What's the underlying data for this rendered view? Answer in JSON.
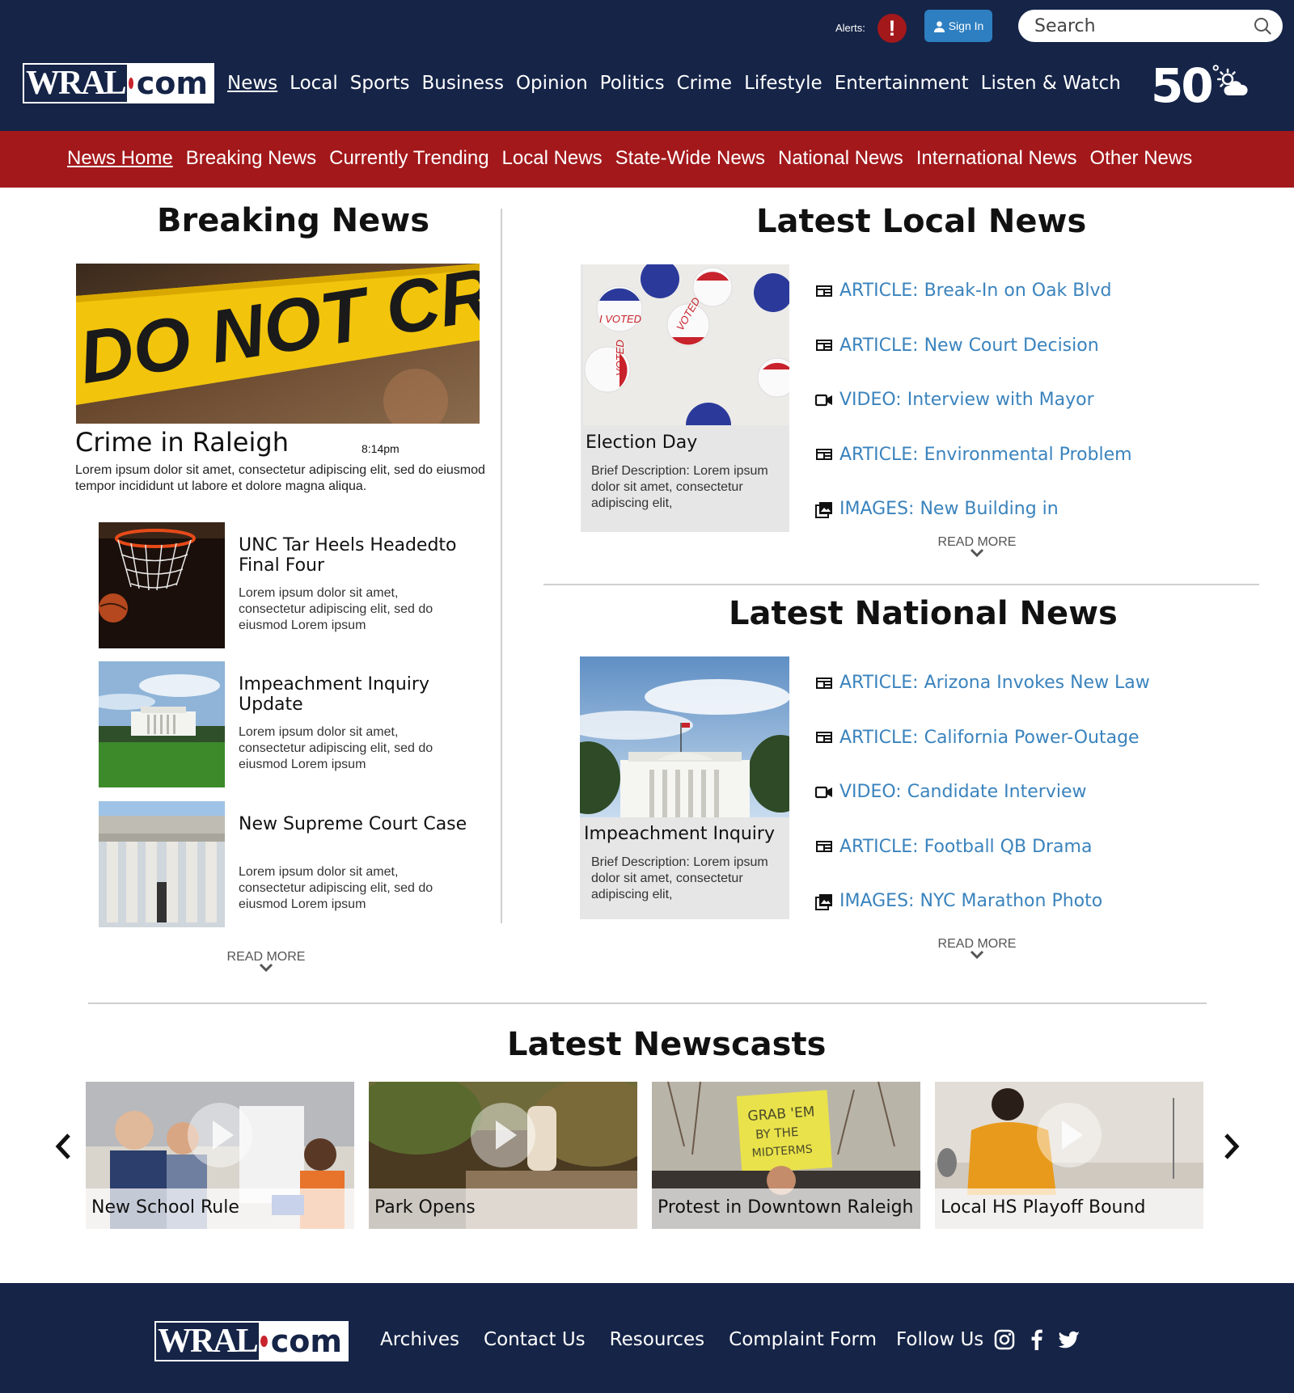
{
  "header": {
    "alerts_label": "Alerts:",
    "alert_glyph": "!",
    "signin_label": "Sign In",
    "search_placeholder": "Search",
    "logo": {
      "wral": "WRAL",
      "com": "com"
    },
    "main_nav": [
      "News",
      "Local",
      "Sports",
      "Business",
      "Opinion",
      "Politics",
      "Crime",
      "Lifestyle",
      "Entertainment",
      "Listen & Watch"
    ],
    "active_nav": "News",
    "weather": {
      "temperature": "50",
      "degree": "°",
      "icon": "partly-cloudy-icon"
    }
  },
  "subnav": {
    "items": [
      "News Home",
      "Breaking News",
      "Currently Trending",
      "Local News",
      "State-Wide News",
      "National News",
      "International News",
      "Other News"
    ],
    "active": "News Home"
  },
  "breaking": {
    "title": "Breaking News",
    "featured": {
      "headline": "Crime in Raleigh",
      "time": "8:14pm",
      "summary": "Lorem ipsum dolor sit amet, consectetur adipiscing elit, sed do eiusmod tempor incididunt ut labore et dolore magna aliqua.",
      "tape_text": "DO NOT CROSS POLICE"
    },
    "stories": [
      {
        "title": "UNC Tar Heels Headedto Final Four",
        "summary": "Lorem ipsum dolor sit amet, consectetur adipiscing elit, sed do eiusmod Lorem ipsum"
      },
      {
        "title": "Impeachment Inquiry Update",
        "summary": "Lorem ipsum dolor sit amet, consectetur adipiscing elit, sed do eiusmod Lorem ipsum"
      },
      {
        "title": "New Supreme Court Case",
        "summary": "Lorem ipsum dolor sit amet, consectetur adipiscing elit, sed do eiusmod Lorem ipsum"
      }
    ],
    "read_more": "READ MORE"
  },
  "local": {
    "title": "Latest Local News",
    "feature": {
      "title": "Election Day",
      "description": "Brief Description: Lorem ipsum dolor sit amet, consectetur adipiscing elit,"
    },
    "links": [
      {
        "type": "article",
        "icon": "article-icon",
        "text": "ARTICLE: Break-In on Oak Blvd"
      },
      {
        "type": "article",
        "icon": "article-icon",
        "text": "ARTICLE: New Court Decision"
      },
      {
        "type": "video",
        "icon": "video-icon",
        "text": "VIDEO: Interview with Mayor"
      },
      {
        "type": "article",
        "icon": "article-icon",
        "text": "ARTICLE: Environmental Problem"
      },
      {
        "type": "images",
        "icon": "images-icon",
        "text": "IMAGES: New Building in"
      }
    ],
    "read_more": "READ MORE"
  },
  "national": {
    "title": "Latest National News",
    "feature": {
      "title": "Impeachment Inquiry",
      "description": "Brief Description: Lorem ipsum dolor sit amet, consectetur adipiscing elit,"
    },
    "links": [
      {
        "type": "article",
        "icon": "article-icon",
        "text": "ARTICLE: Arizona Invokes New Law"
      },
      {
        "type": "article",
        "icon": "article-icon",
        "text": "ARTICLE: California Power-Outage"
      },
      {
        "type": "video",
        "icon": "video-icon",
        "text": "VIDEO: Candidate Interview"
      },
      {
        "type": "article",
        "icon": "article-icon",
        "text": "ARTICLE: Football QB Drama"
      },
      {
        "type": "images",
        "icon": "images-icon",
        "text": "IMAGES: NYC Marathon Photo"
      }
    ],
    "read_more": "READ MORE"
  },
  "newscasts": {
    "title": "Latest Newscasts",
    "items": [
      {
        "caption": "New School Rule"
      },
      {
        "caption": "Park Opens"
      },
      {
        "caption": "Protest in Downtown Raleigh"
      },
      {
        "caption": "Local HS Playoff Bound"
      }
    ]
  },
  "footer": {
    "links": [
      "Archives",
      "Contact Us",
      "Resources",
      "Complaint Form"
    ],
    "follow_label": "Follow Us",
    "social": [
      "instagram-icon",
      "facebook-icon",
      "twitter-icon"
    ]
  },
  "colors": {
    "navy": "#152447",
    "red": "#a3181b",
    "link_blue": "#3a83bd",
    "signin_blue": "#2d7fc1",
    "card_gray": "#e6e6e6"
  }
}
